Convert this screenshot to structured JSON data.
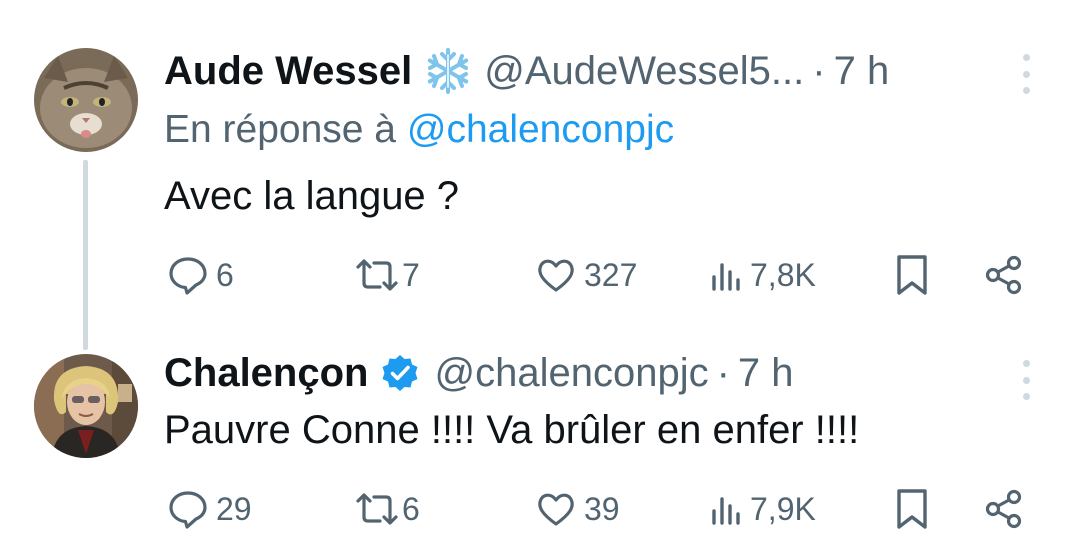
{
  "tweets": [
    {
      "author_name": "Aude Wessel",
      "badge_icon": "snowflake-icon",
      "handle": "@AudeWessel5...",
      "separator": "·",
      "time": "7 h",
      "reply_prefix": "En réponse à",
      "reply_mention": "@chalenconpjc",
      "text": "Avec la langue ?",
      "replies": "6",
      "reposts": "7",
      "likes": "327",
      "views": "7,8K"
    },
    {
      "author_name": "Chalençon",
      "badge_icon": "verified-badge-icon",
      "handle": "@chalenconpjc",
      "separator": "·",
      "time": "7 h",
      "text": "Pauvre Conne !!!! Va brûler en enfer !!!!",
      "replies": "29",
      "reposts": "6",
      "likes": "39",
      "views": "7,9K"
    }
  ],
  "colors": {
    "primary_text": "#0f1419",
    "secondary_text": "#536471",
    "link": "#1d9bf0",
    "thread_line": "#cfd9de",
    "verified": "#1d9bf0"
  }
}
